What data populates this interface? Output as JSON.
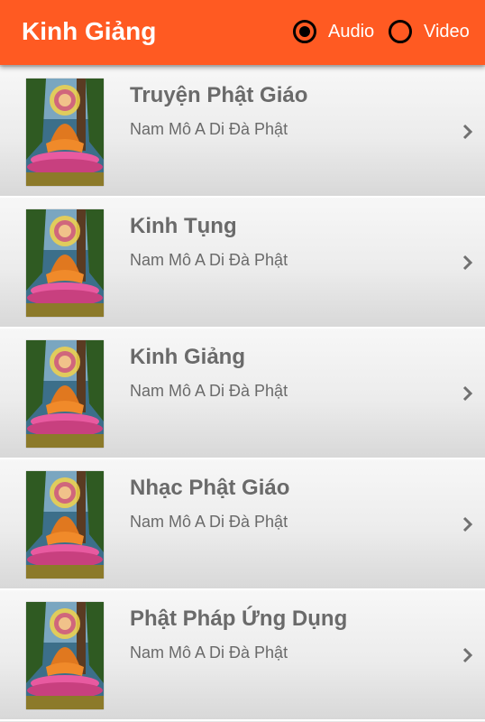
{
  "appbar": {
    "title": "Kinh Giảng",
    "background": "#ff5a22",
    "radio_options": [
      {
        "label": "Audio",
        "selected": true
      },
      {
        "label": "Video",
        "selected": false
      }
    ]
  },
  "list": {
    "items": [
      {
        "title": "Truyện Phật Giáo",
        "subtitle": "Nam Mô A Di Đà Phật",
        "icon": "buddha-thumbnail-image",
        "trailing_icon": "chevron-right-icon"
      },
      {
        "title": "Kinh Tụng",
        "subtitle": "Nam Mô A Di Đà Phật",
        "icon": "buddha-thumbnail-image",
        "trailing_icon": "chevron-right-icon"
      },
      {
        "title": "Kinh Giảng",
        "subtitle": "Nam Mô A Di Đà Phật",
        "icon": "buddha-thumbnail-image",
        "trailing_icon": "chevron-right-icon"
      },
      {
        "title": "Nhạc Phật Giáo",
        "subtitle": "Nam Mô A Di Đà Phật",
        "icon": "buddha-thumbnail-image",
        "trailing_icon": "chevron-right-icon"
      },
      {
        "title": "Phật Pháp Ứng Dụng",
        "subtitle": "Nam Mô A Di Đà Phật",
        "icon": "buddha-thumbnail-image",
        "trailing_icon": "chevron-right-icon"
      }
    ]
  }
}
